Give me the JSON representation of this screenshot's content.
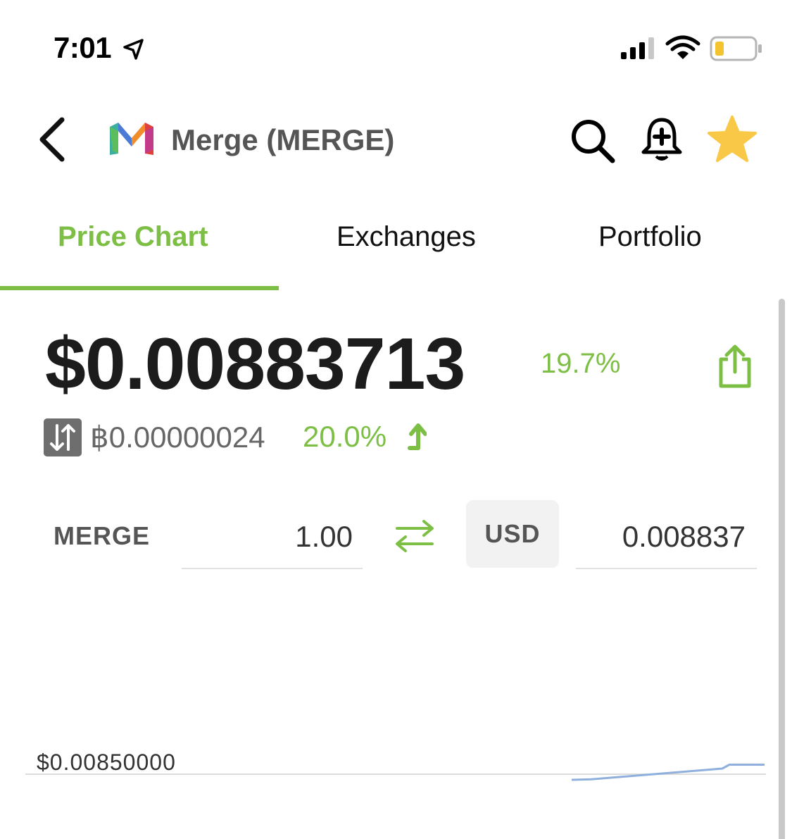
{
  "status_bar": {
    "time": "7:01",
    "icons": [
      "location-arrow-icon",
      "signal-icon",
      "wifi-icon",
      "battery-icon"
    ],
    "battery_color": "#f4c430"
  },
  "header": {
    "back_icon": "chevron-left-icon",
    "coin_logo": "merge-logo",
    "title": "Merge (MERGE)",
    "actions": [
      "search-icon",
      "bell-plus-icon",
      "star-icon"
    ],
    "star_color": "#f8c846"
  },
  "tabs": [
    {
      "label": "Price Chart",
      "active": true
    },
    {
      "label": "Exchanges",
      "active": false
    },
    {
      "label": "Portfolio",
      "active": false
    }
  ],
  "accent_color": "#7dbf45",
  "price": {
    "usd": "$0.00883713",
    "usd_change": "19.7%",
    "btc": "฿0.00000024",
    "btc_change": "20.0%",
    "share_icon": "share-icon"
  },
  "converter": {
    "from_currency": "MERGE",
    "from_value": "1.00",
    "swap_icon": "swap-arrows-icon",
    "to_currency": "USD",
    "to_value": "0.008837"
  },
  "chart_data": {
    "type": "line",
    "gridlines": [
      {
        "label": "$0.00850000",
        "value": 0.0085
      }
    ],
    "line_color": "#8fb0dc",
    "series": [
      {
        "values": [
          0.0083,
          0.00832,
          0.0087,
          0.00883713,
          0.00883713
        ]
      }
    ]
  }
}
